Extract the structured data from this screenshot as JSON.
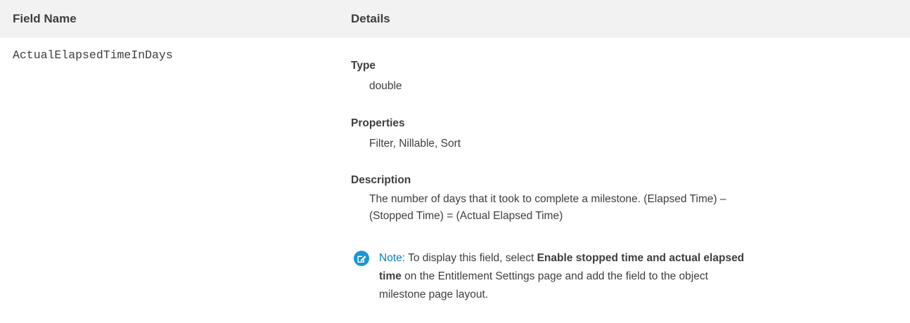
{
  "table": {
    "headers": {
      "field_name": "Field Name",
      "details": "Details"
    },
    "row": {
      "field_name": "ActualElapsedTimeInDays",
      "type_label": "Type",
      "type_value": "double",
      "properties_label": "Properties",
      "properties_value": "Filter, Nillable, Sort",
      "description_label": "Description",
      "description_value": "The number of days that it took to complete a milestone. (Elapsed Time) – (Stopped Time) = (Actual Elapsed Time)",
      "note": {
        "icon": "note-edit-icon",
        "label": "Note:",
        "text_before": "To display this field, select ",
        "bold": "Enable stopped time and actual elapsed time",
        "text_after": " on the Entitlement Settings page and add the field to the object milestone page layout.",
        "icon_color": "#1b96d3",
        "label_color": "#0b7cb8"
      }
    }
  },
  "colors": {
    "header_bg": "#f3f2f2",
    "text": "#3e3e3c"
  }
}
